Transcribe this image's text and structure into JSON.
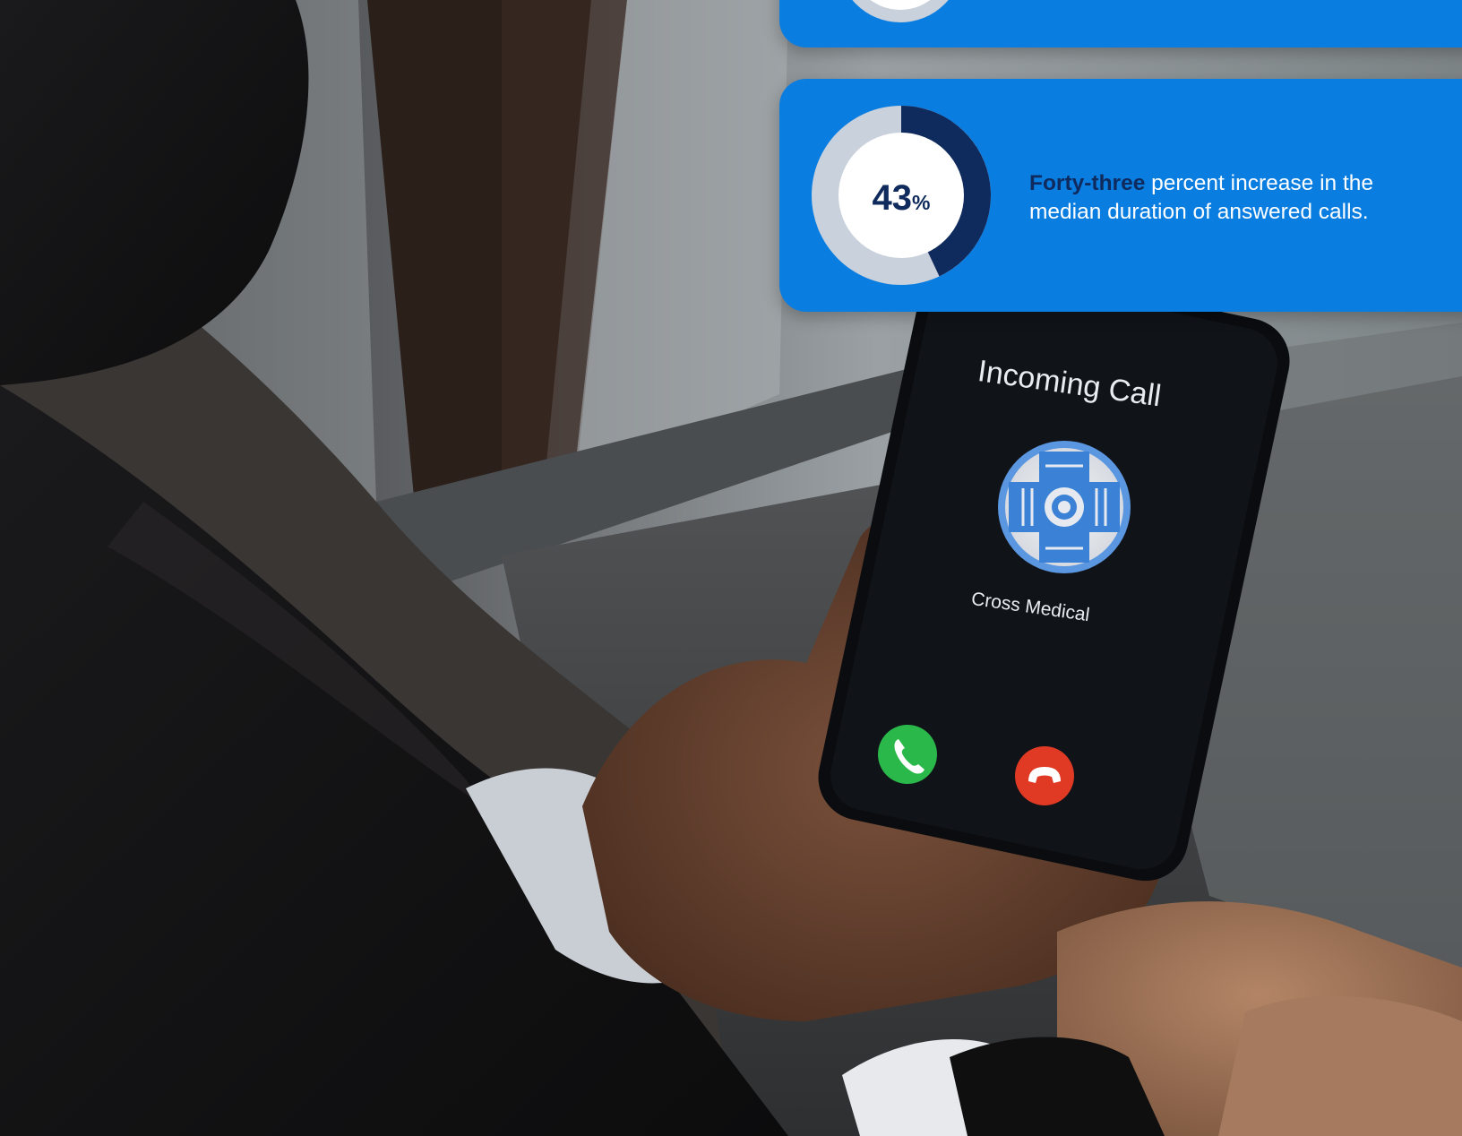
{
  "colors": {
    "card_blue": "#0a7de0",
    "donut_dark": "#0f2a5c",
    "donut_track": "#c9d1dc",
    "accept_green": "#2bb84a",
    "decline_red": "#e03a25",
    "phone_screen": "#101419"
  },
  "stat": {
    "value": "43",
    "unit": "%",
    "percent": 43,
    "highlight": "Forty-three",
    "description": " percent increase in the median duration of answered calls."
  },
  "phone": {
    "call_status": "Incoming Call",
    "caller_name": "Cross Medical",
    "caller_logo_icon": "cross-medical-logo-icon",
    "accept_icon": "phone-accept-icon",
    "decline_icon": "phone-decline-icon"
  }
}
